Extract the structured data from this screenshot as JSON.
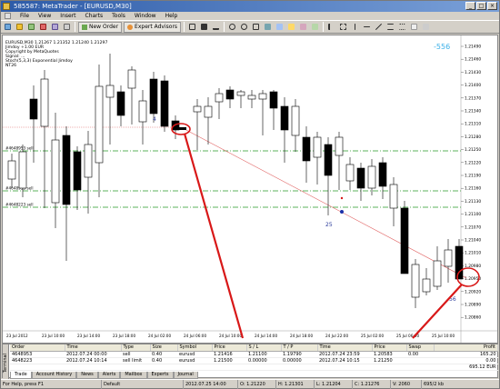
{
  "window": {
    "title": "585587: MetaTrader - [EURUSD,M30]"
  },
  "menu": [
    "File",
    "View",
    "Insert",
    "Charts",
    "Tools",
    "Window",
    "Help"
  ],
  "toolbar": {
    "new_order": "New Order",
    "expert_advisors": "Expert Advisors"
  },
  "chart": {
    "symbol_info": [
      "EURUSD,M30  1.21267 1.21352 1.21240 1.21297",
      "Jimdoy +1.00 EUR",
      "Copyright by MetaQuotes",
      "Signal: ...",
      "Stoch(5,3,3) Exponential  Jimdoy",
      "NT26"
    ],
    "corner_value": "-556",
    "labels": {
      "four": "4",
      "twentyfive": "25",
      "fiftysix": "56"
    },
    "level_labels": {
      "lev1": "#4648953 sell",
      "lev2": "#4648953 sell",
      "lev3": "#4648223 sell"
    },
    "prices": [
      "1.21490",
      "1.21460",
      "1.21430",
      "1.21400",
      "1.21370",
      "1.21340",
      "1.21310",
      "1.21280",
      "1.21250",
      "1.21220",
      "1.21190",
      "1.21160",
      "1.21130",
      "1.21100",
      "1.21070",
      "1.21040",
      "1.21010",
      "1.20980",
      "1.20950",
      "1.20920",
      "1.20890",
      "1.20860"
    ],
    "dates": [
      "23 Jul 2012",
      "23 Jul 10:00",
      "23 Jul 14:00",
      "23 Jul 18:00",
      "24 Jul 02:00",
      "24 Jul 06:00",
      "24 Jul 10:00",
      "24 Jul 14:00",
      "24 Jul 18:00",
      "24 Jul 22:00",
      "25 Jul 02:00",
      "25 Jul 06:00",
      "25 Jul 10:00"
    ],
    "colors": {
      "bull": "#ffffff",
      "bear": "#000000",
      "grid_level": "#2a9a2a",
      "trend_line": "#e06060",
      "highlight": "#d81818",
      "corner_value": "#3ab0e8"
    }
  },
  "orders": {
    "headers": [
      "Order",
      "Time",
      "Type",
      "Size",
      "Symbol",
      "Price",
      "S / L",
      "T / P",
      "Time",
      "Price",
      "Swap",
      "Profit"
    ],
    "rows": [
      [
        "4648953",
        "2012.07.24 00:00",
        "sell",
        "0.40",
        "eurusd",
        "1.21416",
        "1.21100",
        "1.19790",
        "2012.07.24 23:59",
        "1.20583",
        "0.00",
        "165.20"
      ],
      [
        "4648223",
        "2012.07.24 10:14",
        "sell limit",
        "0.40",
        "eurusd",
        "1.21500",
        "0.00000",
        "0.00000",
        "2012.07.24 10:15",
        "1.21250",
        "",
        "0.00"
      ]
    ],
    "total": "695.12 EUR"
  },
  "tabs": [
    "Trade",
    "Account History",
    "News",
    "Alerts",
    "Mailbox",
    "Experts",
    "Journal"
  ],
  "terminal_side": "Terminal",
  "status": [
    "For Help, press F1",
    "Default",
    "2012.07.25 14:00",
    "O: 1.21220",
    "H: 1.21301",
    "L: 1.21204",
    "C: 1.21276",
    "V: 2060",
    "695/2 kb"
  ]
}
